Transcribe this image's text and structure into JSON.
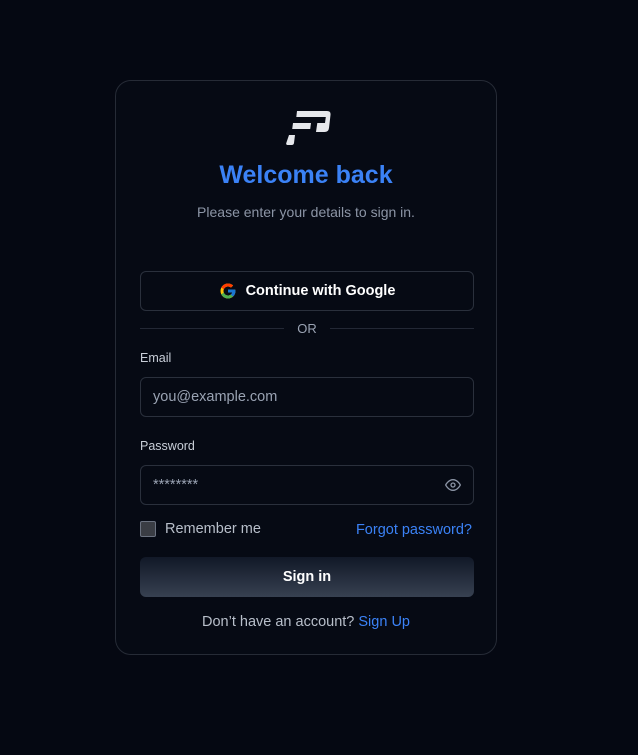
{
  "login": {
    "title": "Welcome back",
    "subtitle": "Please enter your details to sign in.",
    "google_button_label": "Continue with Google",
    "divider_text": "OR",
    "email": {
      "label": "Email",
      "placeholder": "you@example.com",
      "value": ""
    },
    "password": {
      "label": "Password",
      "value": "********"
    },
    "remember_label": "Remember me",
    "remember_checked": false,
    "forgot_label": "Forgot password?",
    "signin_label": "Sign in",
    "signup_prompt": "Don’t have an account?",
    "signup_link": "Sign Up"
  },
  "icons": {
    "logo": "brand-logo-icon",
    "google": "google-g-icon",
    "show_password": "eye-icon"
  },
  "colors": {
    "page_background": "#050812",
    "card_background": "#060a14",
    "accent": "#3b82f6",
    "border": "#262b36",
    "button_gradient_top": "#111827",
    "button_gradient_bottom": "#374151"
  }
}
